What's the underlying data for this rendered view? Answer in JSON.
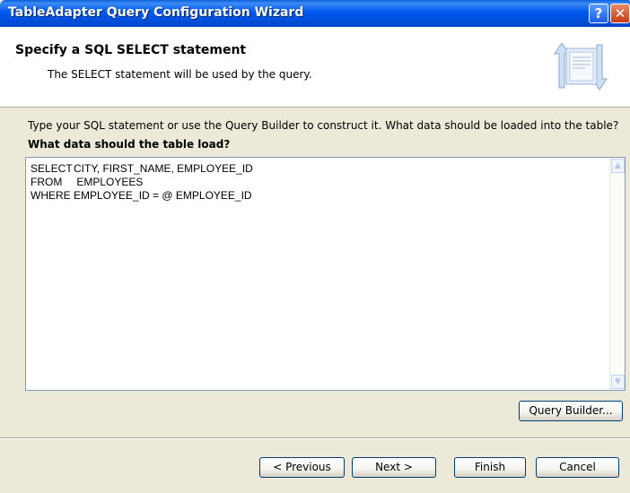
{
  "window": {
    "title": "TableAdapter Query Configuration Wizard",
    "help_label": "?",
    "close_label": "✕"
  },
  "header": {
    "title": "Specify a SQL SELECT statement",
    "subtitle": "The SELECT statement will be used by the query."
  },
  "main": {
    "instruction": "Type your SQL statement or use the Query Builder to construct it. What data should be loaded into the table?",
    "question": "What data should the table load?",
    "sql": [
      {
        "keyword": "SELECT",
        "clause": "CITY, FIRST_NAME, EMPLOYEE_ID"
      },
      {
        "keyword": "FROM",
        "clause": " EMPLOYEES"
      },
      {
        "keyword": "WHERE",
        "clause": "EMPLOYEE_ID = @ EMPLOYEE_ID"
      }
    ],
    "query_builder_label": "Query Builder..."
  },
  "footer": {
    "previous_label": "< Previous",
    "next_label": "Next >",
    "finish_label": "Finish",
    "cancel_label": "Cancel"
  },
  "icons": {
    "help": "help-icon",
    "close": "close-icon",
    "wizard": "database-arrows-icon",
    "scroll_up": "chevron-up-icon",
    "scroll_down": "chevron-down-icon"
  },
  "colors": {
    "title_bar": "#0058ee",
    "dialog_bg": "#ece9d8",
    "header_bg": "#ffffff",
    "button_border": "#003c74"
  }
}
